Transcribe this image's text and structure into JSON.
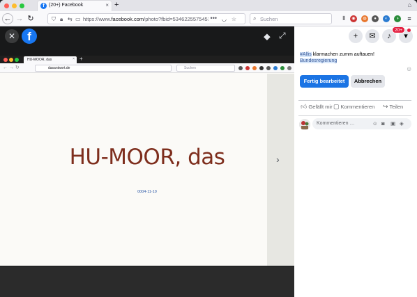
{
  "browser": {
    "tab_title": "(20+) Facebook",
    "favicon_letter": "f",
    "tab_close": "×",
    "newtab": "+",
    "url_prefix": "https://www.",
    "url_domain": "facebook.com",
    "url_rest": "/photo?fbid=534622557545326...",
    "url_more": "•••",
    "search_placeholder": "Suchen"
  },
  "viewer": {
    "close_glyph": "✕",
    "logo_letter": "f",
    "tag_glyph": "⬥",
    "expand_glyph": "⤢",
    "next_glyph": "›"
  },
  "screenshot": {
    "tab_title": "HU-MOOR, das",
    "tab_close": "×",
    "newtab": "+",
    "url": "dasantwort.de",
    "search_placeholder": "Suchen",
    "heading": "HU-MOOR, das",
    "date": "0004-11-10"
  },
  "panel": {
    "notifications_badge": "20+",
    "caption_tag": "#Allis",
    "caption_text": " klarmachen zumm auftauen!",
    "caption_tag2": "Bundesregierung",
    "save_label": "Fertig bearbeitet",
    "cancel_label": "Abbrechen",
    "like_label": "Gefällt mir",
    "comment_label": "Kommentieren",
    "share_label": "Teilen",
    "comment_placeholder": "Kommentieren …"
  },
  "colors": {
    "facebook_blue": "#1877f2",
    "heading_red": "#7e2e1d",
    "badge_red": "#e41e3f"
  },
  "icons": [
    "close-icon",
    "facebook-logo-icon",
    "tag-icon",
    "expand-icon",
    "next-arrow-icon",
    "plus-icon",
    "messenger-icon",
    "bell-icon",
    "chevron-down-icon",
    "like-icon",
    "comment-icon",
    "share-icon",
    "emoji-icon",
    "camera-icon",
    "gif-icon",
    "sticker-icon"
  ]
}
